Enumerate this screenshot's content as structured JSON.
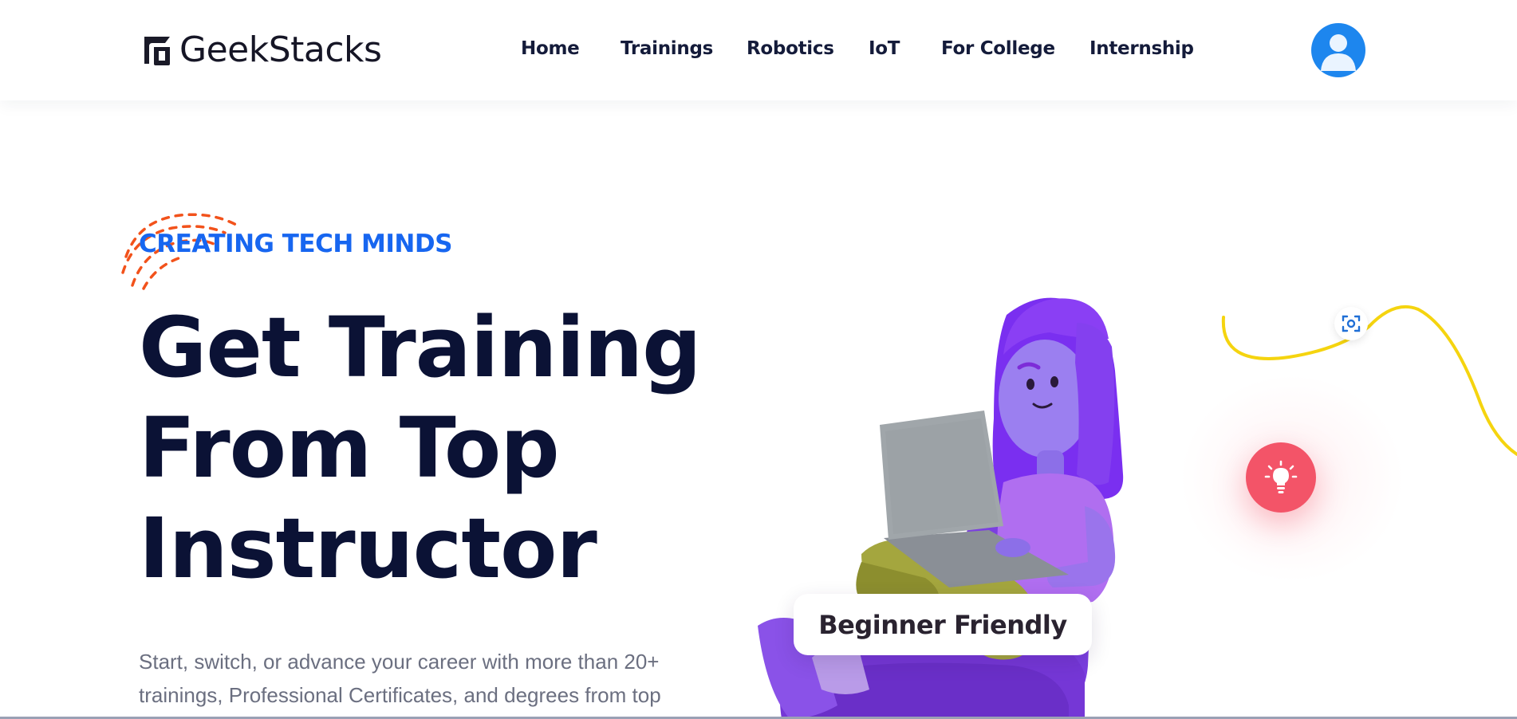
{
  "header": {
    "logo_text": "GeekStacks",
    "nav": [
      {
        "label": "Home"
      },
      {
        "label": "Trainings"
      },
      {
        "label": "Robotics"
      },
      {
        "label": "IoT"
      },
      {
        "label": "For College"
      },
      {
        "label": "Internship"
      }
    ],
    "avatar_icon": "user-icon"
  },
  "hero": {
    "tagline": "CREATING TECH MINDS",
    "headline_lines": [
      "Get Training",
      "From Top",
      "Instructor"
    ],
    "description_lines": [
      "Start, switch, or advance your career with more than 20+",
      "trainings, Professional Certificates, and degrees from top"
    ],
    "badge": "Beginner Friendly",
    "icons": {
      "focus": "focus-icon",
      "bulb": "lightbulb-icon"
    }
  },
  "colors": {
    "primary": "#1766f0",
    "heading": "#0b1235",
    "accent_red": "#f35468",
    "wave_yellow": "#f5d40f",
    "scribble_orange": "#f2521b",
    "avatar_blue": "#1d86ee"
  }
}
